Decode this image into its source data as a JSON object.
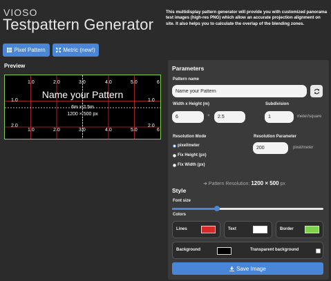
{
  "header": {
    "logo": "VIOSO",
    "title": "Testpattern Generator",
    "intro": "This multidisplay pattern generator will provide you with customized panorama test images (high-res PNG) which allow an accurate projection alignment on site. It also helps you to calculate the overlap of the blending zones."
  },
  "mode_buttons": {
    "pixel_label": "Pixel Pattern",
    "metric_label": "Metric (new!)"
  },
  "preview": {
    "label": "Preview",
    "pattern_name": "Name your Pattern",
    "size_metric": "6m x 2.5m",
    "size_pixels": "1200 × 500 px",
    "top_ticks": [
      "1.0",
      "2.0",
      "3.0",
      "4.0",
      "5.0",
      "6"
    ],
    "bottom_ticks": [
      "1.0",
      "2.0",
      "3.0",
      "4.0",
      "5.0",
      "6"
    ],
    "left_ticks": [
      "1.0",
      "2.0"
    ],
    "right_ticks": [
      "1.0",
      "2.0"
    ],
    "colors": {
      "lines": "#d62a2a",
      "text": "#ffffff",
      "border": "#7fd24a",
      "background": "#000000"
    }
  },
  "parameters": {
    "heading": "Parameters",
    "pattern_name_label": "Pattern name",
    "pattern_name_value": "Name your Pattern",
    "wh_label": "Width x Height (m)",
    "width_value": "6",
    "height_value": "2.5",
    "times": "×",
    "subdivision_label": "Subdivision",
    "subdivision_value": "1",
    "subdivision_unit": "meter/square",
    "resolution_mode_label": "Resolution Mode",
    "modes": [
      "pixel/meter",
      "Fix Height (px)",
      "Fix Width (px)"
    ],
    "selected_mode": 0,
    "resolution_param_label": "Resolution Parameter",
    "resolution_param_value": "200",
    "resolution_param_unit": "pixel/meter",
    "resolution_result_label": "➜ Pattern Resolution:",
    "resolution_result_value": "1200 × 500",
    "resolution_result_unit": "px"
  },
  "style": {
    "heading": "Style",
    "font_size_label": "Font size",
    "font_size_fraction": 0.3,
    "colors_label": "Colors",
    "lines_label": "Lines",
    "text_label": "Text",
    "border_label": "Border",
    "background_label": "Background",
    "transparent_label": "Transparent background",
    "transparent_checked": false,
    "save_label": "Save Image"
  }
}
